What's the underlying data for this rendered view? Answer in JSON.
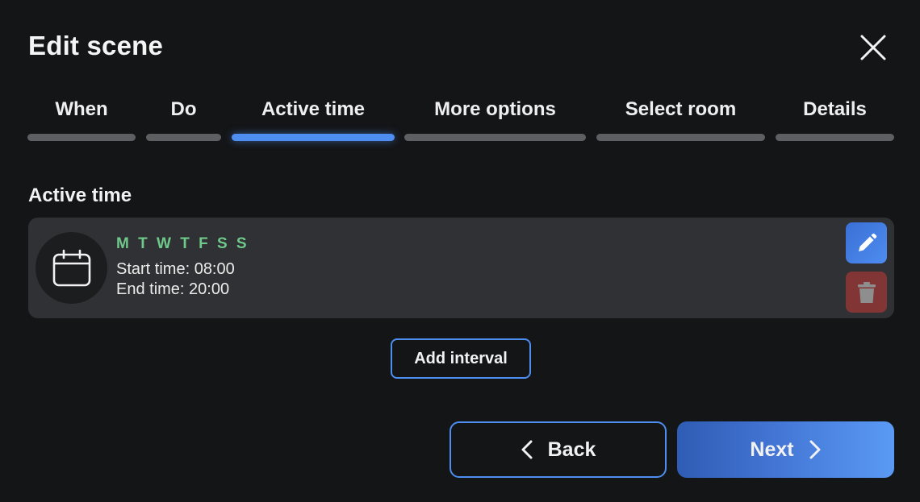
{
  "dialog": {
    "title": "Edit scene",
    "close_icon": "close-icon"
  },
  "tabs": [
    {
      "label": "When",
      "active": false
    },
    {
      "label": "Do",
      "active": false
    },
    {
      "label": "Active time",
      "active": true
    },
    {
      "label": "More options",
      "active": false
    },
    {
      "label": "Select room",
      "active": false
    },
    {
      "label": "Details",
      "active": false
    }
  ],
  "section": {
    "title": "Active time"
  },
  "interval": {
    "icon": "calendar-icon",
    "days": "M T W T F S S",
    "start_time": "Start time: 08:00",
    "end_time": "End time: 20:00",
    "edit_icon": "pencil-icon",
    "delete_icon": "trash-icon"
  },
  "actions": {
    "add_interval": "Add interval",
    "back": "Back",
    "next": "Next"
  },
  "colors": {
    "accent": "#4d8ef0",
    "days_green": "#6ec98a",
    "delete_red": "#823535",
    "background": "#141517",
    "card": "#303134"
  }
}
